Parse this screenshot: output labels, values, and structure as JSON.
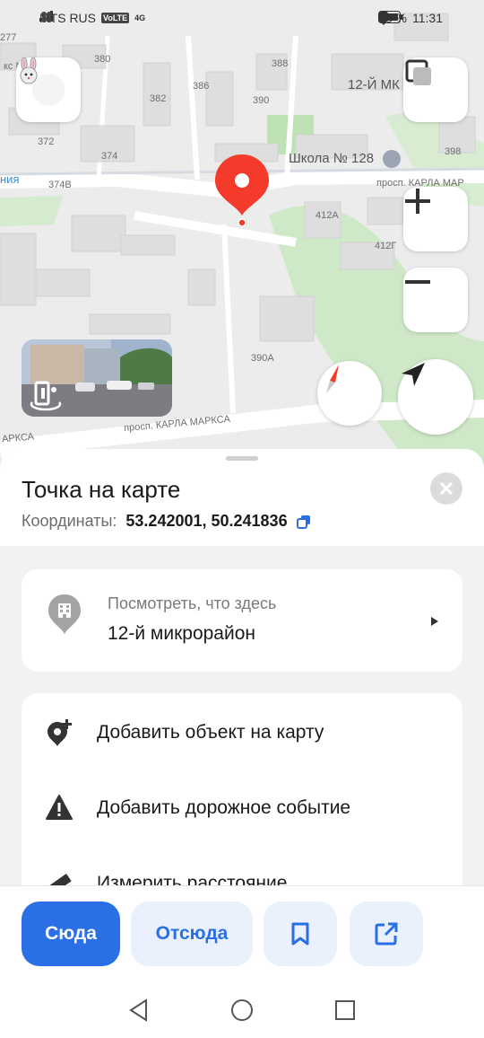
{
  "status_bar": {
    "carrier": "MTS RUS",
    "volte": "VoLTE",
    "network": "4G",
    "battery": "88 %",
    "time": "11:31"
  },
  "map": {
    "labels": {
      "market": "кс Маркет",
      "n380": "380",
      "n388": "388",
      "n386": "386",
      "n382": "382",
      "n390": "390",
      "district": "12-Й МК",
      "n372": "372",
      "n374": "374",
      "school": "Школа № 128",
      "n398": "398",
      "line": "ния",
      "n374v": "374В",
      "street_top": "просп. КАРЛА МАР",
      "n412a": "412А",
      "n412g": "412Г",
      "n390a": "390А",
      "street_bottom": "просп. КАРЛА МАРКСА",
      "street_left": "АРКСА",
      "n277": "277"
    },
    "icons": {
      "profile": "rabbit-avatar-icon",
      "layers": "layers-icon",
      "zoom_in": "plus-icon",
      "zoom_out": "minus-icon",
      "compass": "compass-icon",
      "locate": "navigation-arrow-icon",
      "panorama": "panorama-icon",
      "pin": "map-pin-icon"
    },
    "colors": {
      "pin": "#f33a2b",
      "park": "#cfe9c8"
    }
  },
  "sheet": {
    "title": "Точка на карте",
    "coords_label": "Координаты:",
    "coords_value": "53.242001, 50.241836",
    "place": {
      "subtitle": "Посмотреть, что здесь",
      "name": "12-й микрорайон"
    },
    "actions": [
      {
        "label": "Добавить объект на карту",
        "icon": "add-place-icon"
      },
      {
        "label": "Добавить дорожное событие",
        "icon": "warning-icon"
      },
      {
        "label": "Измерить расстояние",
        "icon": "ruler-icon"
      }
    ]
  },
  "bottom_buttons": {
    "to_here": "Сюда",
    "from_here": "Отсюда",
    "bookmark_icon": "bookmark-icon",
    "share_icon": "share-icon",
    "accent": "#2a6fe6"
  },
  "nav_bar": {
    "back": "back-icon",
    "home": "home-icon",
    "recents": "recents-icon"
  }
}
